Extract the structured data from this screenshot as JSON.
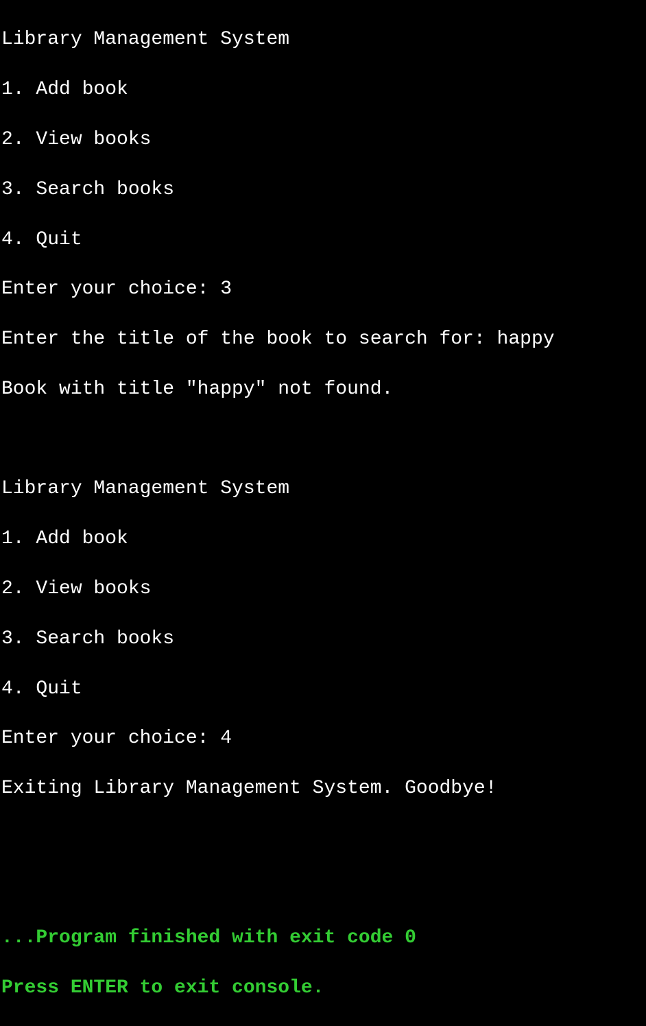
{
  "session1": {
    "header": "Library Management System",
    "menu": [
      "1. Add book",
      "2. View books",
      "3. Search books",
      "4. Quit"
    ],
    "prompt_choice": "Enter your choice: ",
    "choice_value": "3",
    "prompt_title": "Enter the title of the book to search for: ",
    "title_value": "happy",
    "result": "Book with title \"happy\" not found."
  },
  "session2": {
    "header": "Library Management System",
    "menu": [
      "1. Add book",
      "2. View books",
      "3. Search books",
      "4. Quit"
    ],
    "prompt_choice": "Enter your choice: ",
    "choice_value": "4",
    "result": "Exiting Library Management System. Goodbye!"
  },
  "footer": {
    "line1": "...Program finished with exit code 0",
    "line2": "Press ENTER to exit console."
  }
}
